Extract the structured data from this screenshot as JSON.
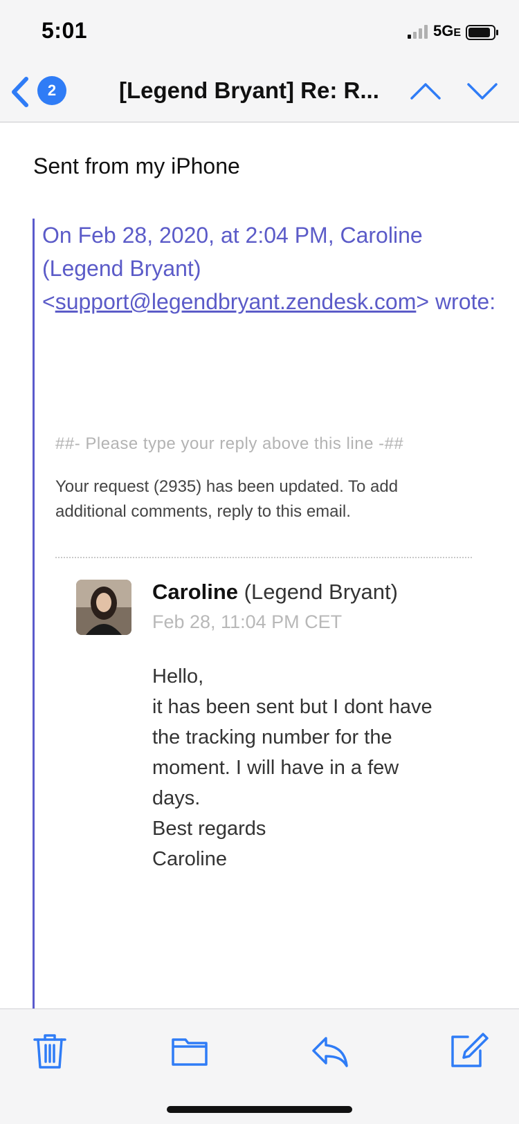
{
  "status_bar": {
    "time": "5:01",
    "network": "5G",
    "network_sub": "E"
  },
  "nav": {
    "back_count": "2",
    "title": "[Legend Bryant] Re: R..."
  },
  "email": {
    "sent_from": "Sent from my iPhone",
    "quote_prefix": "On Feb 28, 2020, at 2:04 PM, Caroline (Legend Bryant) <",
    "quote_email": "support@legendbryant.zendesk.com",
    "quote_suffix": "> wrote:",
    "reply_line": "##- Please type your reply above this line -##",
    "update_text": "Your request (2935) has been updated. To add additional comments, reply to this email.",
    "author_name": "Caroline",
    "author_org": " (Legend Bryant)",
    "date": "Feb 28, 11:04 PM CET",
    "message_lines": [
      "Hello,",
      "it has been sent but I dont have",
      "the tracking number for the",
      "moment. I will have in a few",
      "days.",
      "Best regards",
      "Caroline"
    ]
  },
  "colors": {
    "accent": "#2f7cf6",
    "quote": "#5b5bc8"
  }
}
